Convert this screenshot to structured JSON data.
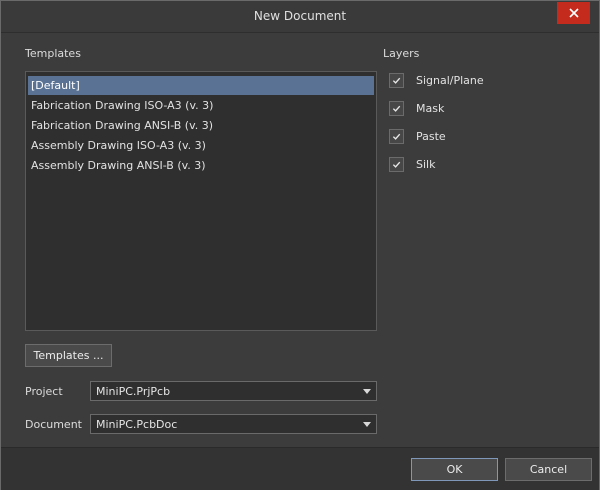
{
  "window": {
    "title": "New Document"
  },
  "templates": {
    "label": "Templates",
    "items": [
      {
        "label": "[Default]",
        "selected": true
      },
      {
        "label": "Fabrication Drawing ISO-A3 (v. 3)",
        "selected": false
      },
      {
        "label": "Fabrication Drawing ANSI-B (v. 3)",
        "selected": false
      },
      {
        "label": "Assembly Drawing ISO-A3 (v. 3)",
        "selected": false
      },
      {
        "label": "Assembly Drawing ANSI-B (v. 3)",
        "selected": false
      }
    ],
    "button_label": "Templates ..."
  },
  "layers": {
    "label": "Layers",
    "items": [
      {
        "label": "Signal/Plane",
        "checked": true
      },
      {
        "label": "Mask",
        "checked": true
      },
      {
        "label": "Paste",
        "checked": true
      },
      {
        "label": "Silk",
        "checked": true
      }
    ]
  },
  "project": {
    "label": "Project",
    "value": "MiniPC.PrjPcb"
  },
  "document": {
    "label": "Document",
    "value": "MiniPC.PcbDoc"
  },
  "footer": {
    "ok_label": "OK",
    "cancel_label": "Cancel"
  },
  "colors": {
    "selection": "#5a7394",
    "close": "#c42b1c",
    "background": "#3c3c3c"
  }
}
